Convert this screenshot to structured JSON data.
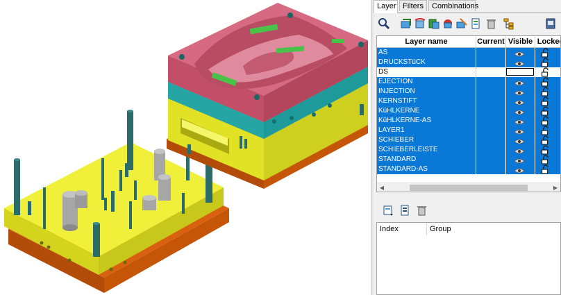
{
  "panel": {
    "tabs": [
      {
        "label": "Layer",
        "active": true
      },
      {
        "label": "Filters",
        "active": false
      },
      {
        "label": "Combinations",
        "active": false
      }
    ],
    "toolbar_icons": [
      "search-icon",
      "layer-new-icon",
      "layer-copy-icon",
      "layer-move-icon",
      "layer-merge-icon",
      "layer-rename-icon",
      "layer-properties-icon",
      "delete-icon",
      "hierarchy-icon",
      "export-icon"
    ],
    "layer_table": {
      "columns": [
        "Layer name",
        "Current",
        "Visible",
        "Locked"
      ],
      "rows": [
        {
          "name": "AS",
          "selected": true,
          "visible": true,
          "locked": "unlocked"
        },
        {
          "name": "DRUCKSTüCK",
          "selected": true,
          "visible": true,
          "locked": "unlocked"
        },
        {
          "name": "DS",
          "selected": false,
          "visible": false,
          "locked": "unlocked"
        },
        {
          "name": "EJECTION",
          "selected": true,
          "visible": true,
          "locked": "unlocked"
        },
        {
          "name": "INJECTION",
          "selected": true,
          "visible": true,
          "locked": "unlocked"
        },
        {
          "name": "KERNSTIFT",
          "selected": true,
          "visible": true,
          "locked": "unlocked"
        },
        {
          "name": "KüHLKERNE",
          "selected": true,
          "visible": true,
          "locked": "unlocked"
        },
        {
          "name": "KüHLKERNE-AS",
          "selected": true,
          "visible": true,
          "locked": "unlocked"
        },
        {
          "name": "LAYER1",
          "selected": true,
          "visible": true,
          "locked": "unlocked"
        },
        {
          "name": "SCHIEBER",
          "selected": true,
          "visible": true,
          "locked": "unlocked"
        },
        {
          "name": "SCHIEBERLEISTE",
          "selected": true,
          "visible": true,
          "locked": "unlocked"
        },
        {
          "name": "STANDARD",
          "selected": true,
          "visible": true,
          "locked": "unlocked"
        },
        {
          "name": "STANDARD-AS",
          "selected": true,
          "visible": true,
          "locked": "unlocked"
        }
      ]
    },
    "group_toolbar_icons": [
      "group-add-icon",
      "group-edit-icon",
      "group-delete-icon"
    ],
    "group_table": {
      "columns": [
        "Index",
        "Group"
      ]
    }
  },
  "colors": {
    "selection": "#0a78d7",
    "mold_cavity": "#c9546d",
    "mold_plate_cyan": "#2db5b5",
    "mold_plate_yellow": "#e8e830",
    "mold_base_orange": "#d8600f",
    "pins": "#2b6b6a"
  }
}
